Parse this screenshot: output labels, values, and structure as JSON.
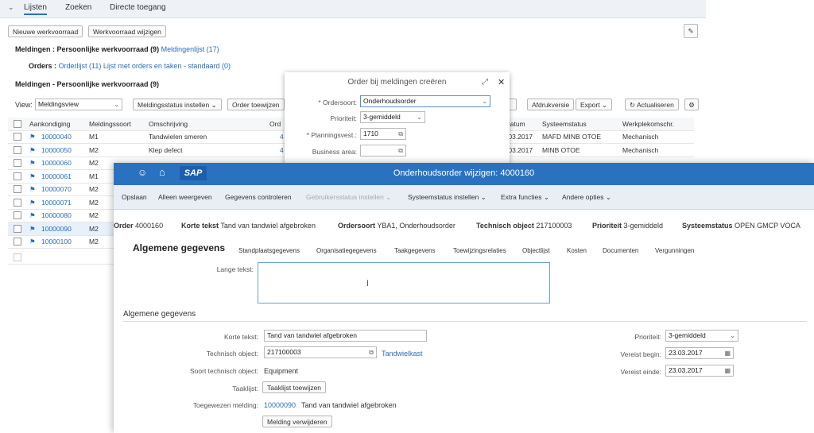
{
  "topnav": {
    "tabs": [
      "Lijsten",
      "Zoeken",
      "Directe toegang"
    ]
  },
  "list_toolbar": {
    "new_label": "Nieuwe werkvoorraad",
    "edit_label": "Werkvoorraad wijzigen"
  },
  "meldingen_line": {
    "label": "Meldingen :",
    "value": "Persoonlijke werkvoorraad (9)",
    "link": "Meldingenlijst (17)"
  },
  "orders_line": {
    "label": "Orders :",
    "link1": "Orderlijst (11)",
    "link2": "Lijst met orders en taken - standaard (0)"
  },
  "section_title": "Meldingen - Persoonlijke werkvoorraad (9)",
  "view": {
    "label": "View:",
    "value": "Meldingsview",
    "status_btn": "Meldingsstatus instellen",
    "order_btn": "Order toewijzen",
    "print_btn": "Afdrukversie",
    "export_btn": "Export",
    "refresh_btn": "Actualiseren"
  },
  "table": {
    "headers": [
      "Aankondiging",
      "Meldingssoort",
      "Omschrijving",
      "Ord",
      "datum",
      "Systeemstatus",
      "Werkplekomschr."
    ],
    "rows": [
      {
        "id": "10000040",
        "type": "M1",
        "desc": "Tandwielen smeren",
        "ord": "4",
        "date": ".03.2017",
        "status": "MAFD MINB OTOE",
        "wp": "Mechanisch"
      },
      {
        "id": "10000050",
        "type": "M2",
        "desc": "Klep defect",
        "ord": "4",
        "date": ".03.2017",
        "status": "MINB OTOE",
        "wp": "Mechanisch"
      },
      {
        "id": "10000060",
        "type": "M2",
        "desc": "",
        "ord": "",
        "date": "",
        "status": "",
        "wp": ""
      },
      {
        "id": "10000061",
        "type": "M1",
        "desc": "",
        "ord": "",
        "date": "",
        "status": "",
        "wp": ""
      },
      {
        "id": "10000070",
        "type": "M2",
        "desc": "",
        "ord": "",
        "date": "",
        "status": "",
        "wp": ""
      },
      {
        "id": "10000071",
        "type": "M2",
        "desc": "",
        "ord": "",
        "date": "",
        "status": "",
        "wp": ""
      },
      {
        "id": "10000080",
        "type": "M2",
        "desc": "",
        "ord": "",
        "date": "",
        "status": "",
        "wp": ""
      },
      {
        "id": "10000090",
        "type": "M2",
        "desc": "",
        "ord": "",
        "date": "",
        "status": "",
        "wp": ""
      },
      {
        "id": "10000100",
        "type": "M2",
        "desc": "",
        "ord": "",
        "date": "",
        "status": "",
        "wp": ""
      }
    ]
  },
  "dialog": {
    "title": "Order bij meldingen creëren",
    "ordersoort_label": "* Ordersoort:",
    "ordersoort_value": "Onderhoudsorder",
    "prioriteit_label": "Prioriteit:",
    "prioriteit_value": "3-gemiddeld",
    "planning_label": "* Planningsvest.:",
    "planning_value": "1710",
    "business_label": "Business area:"
  },
  "order": {
    "logo": "SAP",
    "title": "Onderhoudsorder wijzigen: 4000160",
    "toolbar": [
      "Opslaan",
      "Alleen weergeven",
      "Gegevens controleren",
      "Gebruikersstatus instellen",
      "Systeemstatus instellen",
      "Extra functies",
      "Andere opties"
    ],
    "header": {
      "order_label": "Order",
      "order_value": "4000160",
      "kt_label": "Korte tekst",
      "kt_value": "Tand van tandwiel afgebroken",
      "os_label": "Ordersoort",
      "os_value": "YBA1, Onderhoudsorder",
      "to_label": "Technisch object",
      "to_value": "217100003",
      "pr_label": "Prioriteit",
      "pr_value": "3-gemiddeld",
      "ss_label": "Systeemstatus",
      "ss_value": "OPEN GMCP VOCA"
    },
    "tabs": [
      "Algemene gegevens",
      "Standplaatsgegevens",
      "Organisatiegegevens",
      "Taakgegevens",
      "Toewijzingsrelaties",
      "Objectlijst",
      "Kosten",
      "Documenten",
      "Vergunningen"
    ],
    "lange_tekst_label": "Lange tekst:",
    "section": "Algemene gegevens",
    "form": {
      "kt_label": "Korte tekst:",
      "kt_value": "Tand van tandwiel afgebroken",
      "to_label": "Technisch object:",
      "to_value": "217100003",
      "to_link": "Tandwielkast",
      "sto_label": "Soort technisch object:",
      "sto_value": "Equipment",
      "tl_label": "Taaklijst:",
      "tl_btn": "Taaklijst toewijzen",
      "tm_label": "Toegewezen melding:",
      "tm_link": "10000090",
      "tm_text": "Tand van tandwiel afgebroken",
      "mv_btn": "Melding verwijderen",
      "prio_label": "Prioriteit:",
      "prio_value": "3-gemiddeld",
      "vb_label": "Vereist begin:",
      "vb_value": "23.03.2017",
      "ve_label": "Vereist einde:",
      "ve_value": "23.03.2017"
    }
  }
}
